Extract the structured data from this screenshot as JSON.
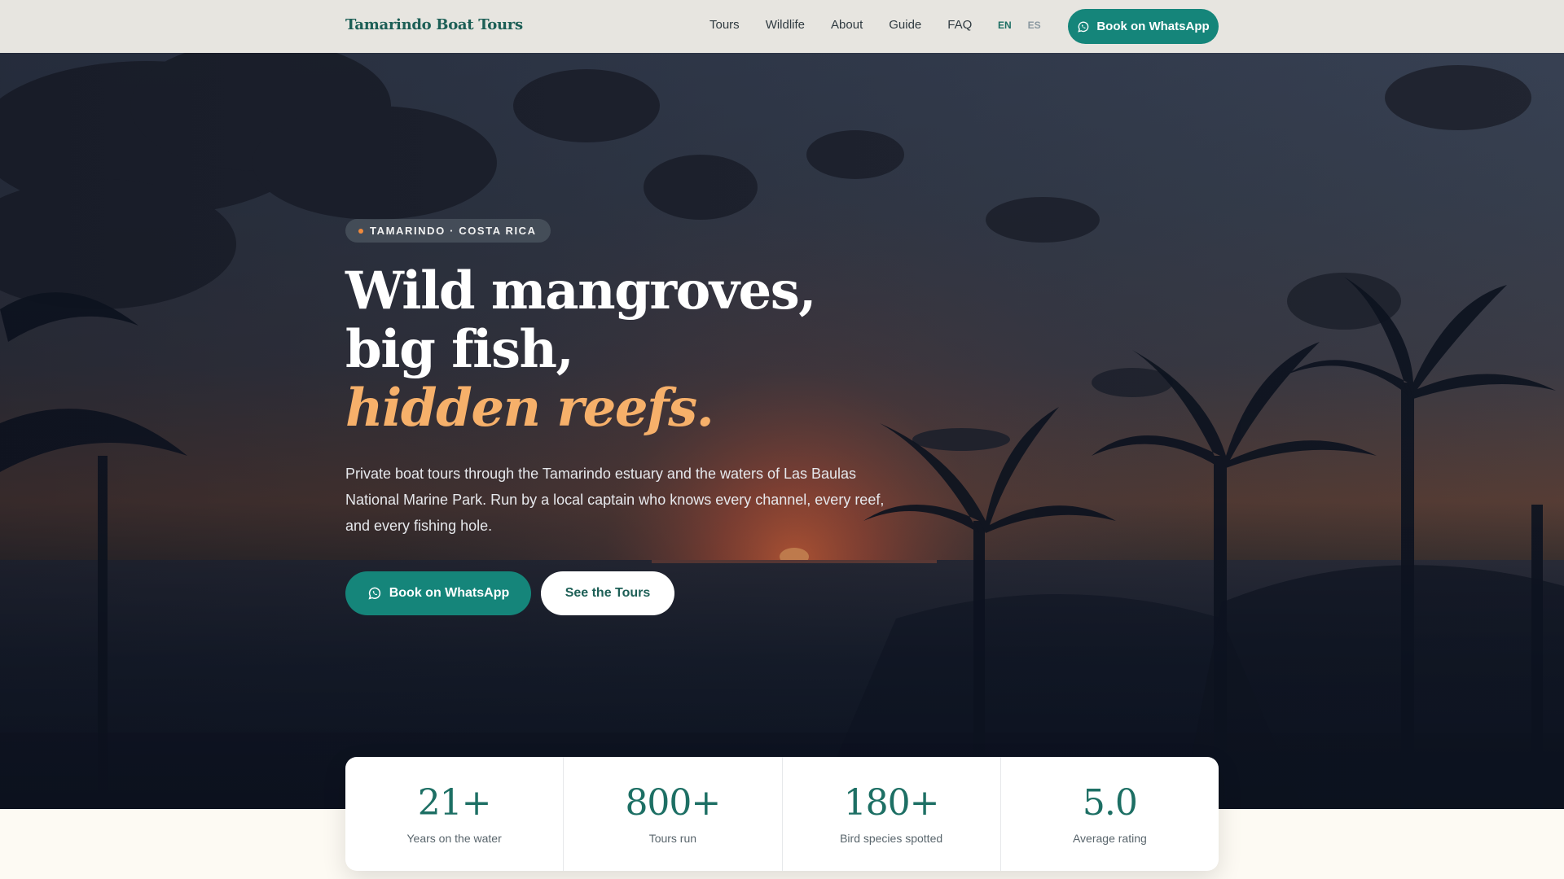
{
  "header": {
    "brand": "Tamarindo Boat Tours",
    "nav": [
      "Tours",
      "Wildlife",
      "About",
      "Guide",
      "FAQ"
    ],
    "lang_active": "EN",
    "lang_other": "ES",
    "cta_label": "Book on WhatsApp"
  },
  "hero": {
    "tagline": "TAMARINDO · COSTA RICA",
    "headline_line1": "Wild mangroves, big fish,",
    "headline_accent": "hidden reefs.",
    "description": "Private boat tours through the Tamarindo estuary and the waters of Las Baulas National Marine Park. Run by a local captain who knows every channel, every reef, and every fishing hole.",
    "primary_cta": "Book on WhatsApp",
    "secondary_cta": "See the Tours"
  },
  "stats": [
    {
      "value": "21+",
      "label": "Years on the water"
    },
    {
      "value": "800+",
      "label": "Tours run"
    },
    {
      "value": "180+",
      "label": "Bird species spotted"
    },
    {
      "value": "5.0",
      "label": "Average rating"
    }
  ],
  "colors": {
    "brand": "#1d5f56",
    "primary_button": "#15857a",
    "accent": "#f6b06a",
    "tag_dot": "#f08a3c",
    "header_bg": "#e7e5e0",
    "page_bg": "#fdfaf3"
  },
  "icons": {
    "whatsapp": "whatsapp-icon"
  }
}
